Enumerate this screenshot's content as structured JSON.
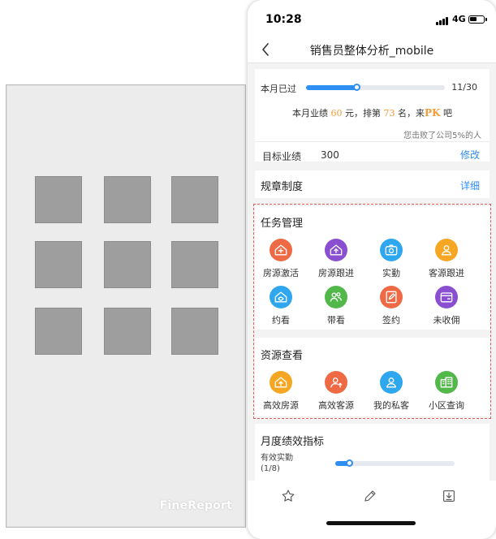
{
  "watermark": {
    "brand": "FineReport"
  },
  "status_bar": {
    "time": "10:28",
    "network": "4G"
  },
  "nav": {
    "title": "销售员整体分析_mobile",
    "back_icon": "chevron-left-icon"
  },
  "monthly_progress": {
    "label": "本月已过",
    "days": "11/30",
    "fraction": 0.3667,
    "rank_prefix": "本月业绩",
    "amount": "60",
    "rank_middle": "元，排第",
    "rank_number": "73",
    "rank_suffix": "名，来",
    "pk": "PK",
    "rank_end": "吧",
    "beat_text": "您击败了公司5%的人",
    "target_label": "目标业绩",
    "target_value": "300",
    "edit_label": "修改"
  },
  "rules": {
    "title": "规章制度",
    "detail_label": "详细"
  },
  "tasks": {
    "title": "任务管理",
    "items": [
      {
        "label": "房源激活",
        "icon": "house-plus-icon",
        "color": "#ee6a45"
      },
      {
        "label": "房源跟进",
        "icon": "house-upload-icon",
        "color": "#8a4ed0"
      },
      {
        "label": "实勤",
        "icon": "camera-icon",
        "color": "#2ea7ef"
      },
      {
        "label": "客源跟进",
        "icon": "person-icon",
        "color": "#f5a623"
      },
      {
        "label": "约看",
        "icon": "house-eye-icon",
        "color": "#2ea7ef"
      },
      {
        "label": "带看",
        "icon": "people-icon",
        "color": "#52b84a"
      },
      {
        "label": "签约",
        "icon": "sign-pen-icon",
        "color": "#ee6a45"
      },
      {
        "label": "未收佣",
        "icon": "wallet-icon",
        "color": "#8a4ed0"
      }
    ]
  },
  "resources": {
    "title": "资源查看",
    "items": [
      {
        "label": "高效房源",
        "icon": "house-up-icon",
        "color": "#f5a623"
      },
      {
        "label": "高效客源",
        "icon": "person-up-icon",
        "color": "#ee6a45"
      },
      {
        "label": "我的私客",
        "icon": "person-icon",
        "color": "#2ea7ef"
      },
      {
        "label": "小区查询",
        "icon": "buildings-icon",
        "color": "#52b84a"
      }
    ]
  },
  "kpi": {
    "title": "月度绩效指标",
    "label_line1": "有效实勤",
    "label_line2": "(1/8)",
    "fraction": 0.125
  },
  "toolbar": {
    "icons": [
      "star-icon",
      "pencil-icon",
      "download-icon"
    ]
  },
  "colors": {
    "accent": "#2e8ef2",
    "highlight_border": "#d95d5d",
    "rank_number": "#f29b38"
  }
}
